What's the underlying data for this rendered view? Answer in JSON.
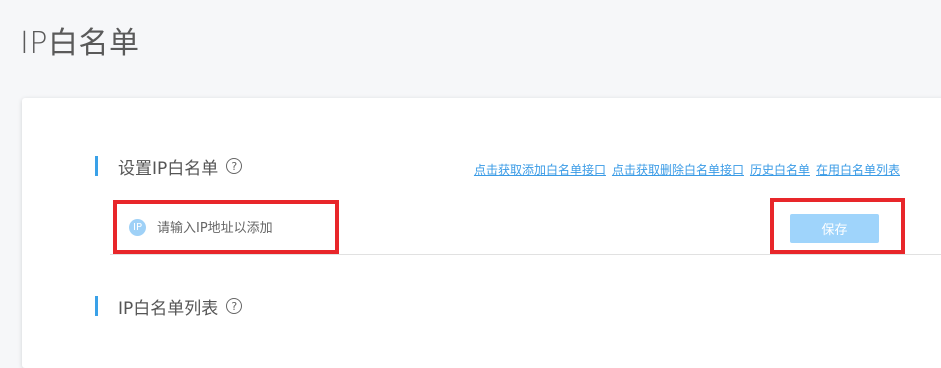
{
  "page": {
    "title": "IP白名单"
  },
  "settings_section": {
    "title": "设置IP白名单",
    "help": "?",
    "links": [
      "点击获取添加白名单接口",
      "点击获取删除白名单接口",
      "历史白名单",
      "在用白名单列表"
    ],
    "ip_badge": "IP",
    "ip_input": {
      "value": "",
      "placeholder": "请输入IP地址以添加"
    },
    "save_label": "保存"
  },
  "list_section": {
    "title": "IP白名单列表",
    "help": "?"
  },
  "colors": {
    "accent": "#3aa1e8",
    "link": "#3a9be6",
    "button": "#9fd4fb",
    "highlight": "#e8262a"
  },
  "icons": [
    "help-icon",
    "ip-icon"
  ]
}
